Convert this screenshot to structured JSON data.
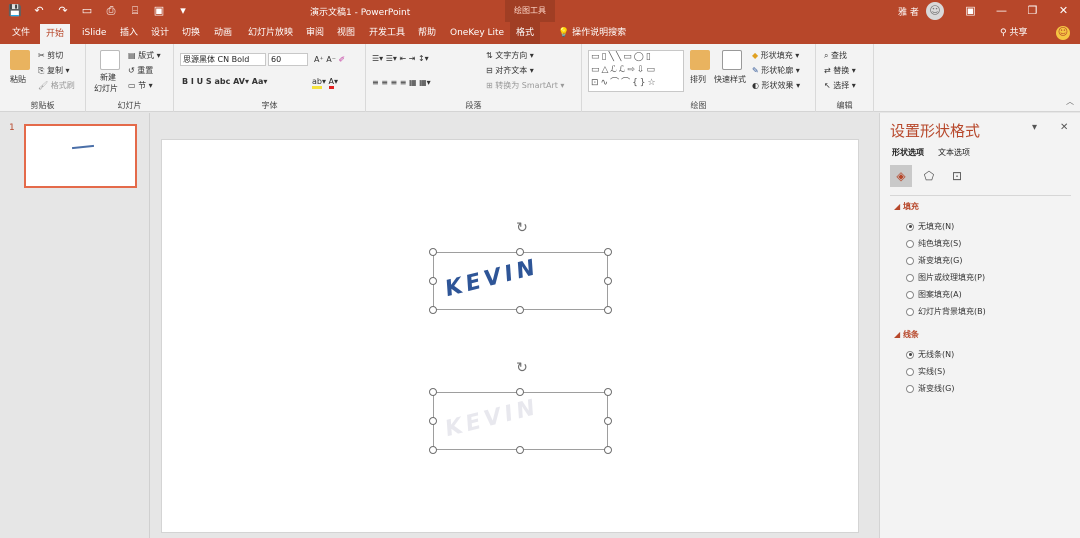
{
  "titlebar": {
    "doc_title": "演示文稿1 - PowerPoint",
    "context_tab_title": "绘图工具",
    "user": "雅 者",
    "qat": [
      "💾",
      "↶",
      "↷",
      "▭",
      "⎙",
      "⌸",
      "▣",
      "▾"
    ],
    "win_controls": [
      "▣",
      "—",
      "❐",
      "✕"
    ]
  },
  "tabs": [
    "文件",
    "开始",
    "iSlide",
    "插入",
    "设计",
    "切换",
    "动画",
    "幻灯片放映",
    "审阅",
    "视图",
    "开发工具",
    "帮助",
    "OneKey Lite",
    "格式"
  ],
  "tellme": "操作说明搜索",
  "share": "共享",
  "ribbon": {
    "clipboard": {
      "label": "剪贴板",
      "paste": "粘贴",
      "cut": "剪切",
      "copy": "复制",
      "format_painter": "格式刷"
    },
    "slides": {
      "label": "幻灯片",
      "new_slide_1": "新建",
      "new_slide_2": "幻灯片",
      "layout": "版式",
      "reset": "重置",
      "section": "节"
    },
    "font": {
      "label": "字体",
      "font_name": "思源黑体 CN Bold",
      "font_size": "60"
    },
    "paragraph": {
      "label": "段落",
      "text_direction": "文字方向",
      "align_text": "对齐文本",
      "smartart": "转换为 SmartArt"
    },
    "drawing": {
      "label": "绘图",
      "arrange": "排列",
      "quick_styles": "快速样式",
      "shape_fill": "形状填充",
      "shape_outline": "形状轮廓",
      "shape_effects": "形状效果",
      "shapes_glyphs": "▭▯╲╲▭◯▯ ▭△ℒℒ⇨⇩▭ ⊡∿⌒⌒{}☆"
    },
    "editing": {
      "label": "编辑",
      "find": "查找",
      "replace": "替换",
      "select": "选择"
    }
  },
  "thumbs": [
    {
      "number": "1"
    }
  ],
  "slide": {
    "wordart_1": "KEVIN",
    "wordart_2": "KEVIN",
    "text_color": "#2e5597"
  },
  "format_pane": {
    "title": "设置形状格式",
    "tab_shape": "形状选项",
    "tab_text": "文本选项",
    "fill_heading": "填充",
    "fill_options": [
      "无填充(N)",
      "纯色填充(S)",
      "渐变填充(G)",
      "图片或纹理填充(P)",
      "图案填充(A)",
      "幻灯片背景填充(B)"
    ],
    "line_heading": "线条",
    "line_options": [
      "无线条(N)",
      "实线(S)",
      "渐变线(G)"
    ]
  },
  "colors": {
    "accent": "#b7472a"
  }
}
